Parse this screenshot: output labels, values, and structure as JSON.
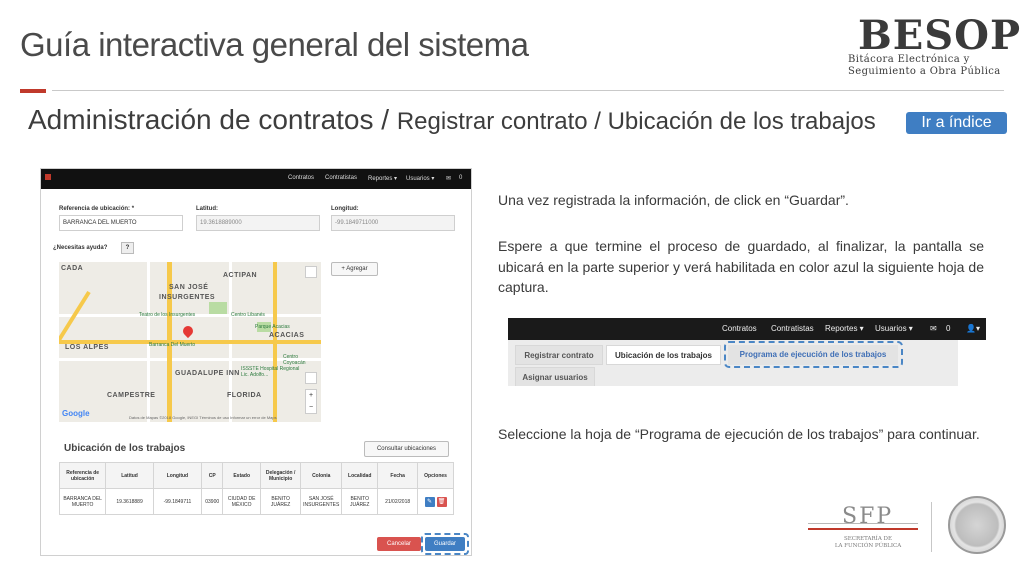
{
  "slide": {
    "title": "Guía interactiva general del sistema",
    "section_main": "Administración de contratos / ",
    "section_sub": "Registrar contrato / Ubicación de los trabajos",
    "index_button": "Ir a índice"
  },
  "logo": {
    "name": "BESOP",
    "line1": "Bitácora Electrónica y",
    "line2": "Seguimiento a Obra Pública"
  },
  "shot1": {
    "nav": [
      "Contratos",
      "Contratistas",
      "Reportes ▾",
      "Usuarios ▾",
      "✉",
      "0"
    ],
    "ref_label": "Referencia de ubicación: *",
    "ref_value": "BARRANCA DEL MUERTO",
    "lat_label": "Latitud:",
    "lat_value": "19.3618889000",
    "lon_label": "Longitud:",
    "lon_value": "-99.1849711000",
    "help_label": "¿Necesitas ayuda?",
    "help_button": "?",
    "add_button": "+ Agregar",
    "map": {
      "labels": [
        "ACTIPAN",
        "SAN JOSÉ",
        "INSURGENTES",
        "ACACIAS",
        "LOS ALPES",
        "GUADALUPE INN",
        "CAMPESTRE",
        "FLORIDA",
        "CADA"
      ],
      "pois": [
        "Teatro de los Insurgentes",
        "Centro Libanés",
        "Parque Acacias",
        "Barranca Del Muerto",
        "Centro Coyoacán",
        "ISSSTE Hospital Regional Lic. Adolfo..."
      ],
      "google": "Google",
      "credits": "Datos de Mapas ©2018 Google, INEGI   Términos de uso   Informar un error de Maps",
      "zoom_in": "+",
      "zoom_out": "−"
    },
    "table_title": "Ubicación de los trabajos",
    "consult_button": "Consultar ubicaciones",
    "columns": [
      "Referencia de ubicación",
      "Latitud",
      "Longitud",
      "CP",
      "Estado",
      "Delegación / Municipio",
      "Colonia",
      "Localidad",
      "Fecha",
      "Opciones"
    ],
    "row": [
      "BARRANCA DEL MUERTO",
      "19.3618889",
      "-99.1849711",
      "03900",
      "CIUDAD DE MÉXICO",
      "BENITO JUÁREZ",
      "SAN JOSÉ INSURGENTES",
      "BENITO JUÁREZ",
      "21/02/2018"
    ],
    "edit_icon": "✎",
    "delete_icon": "🗑",
    "cancel_button": "Cancelar",
    "save_button": "Guardar"
  },
  "text": {
    "p1": "Una vez registrada la información, de click en “Guardar”.",
    "p2": "Espere a que termine el proceso de guardado, al finalizar, la pantalla se ubicará en la parte superior y verá habilitada en color azul la siguiente hoja de captura.",
    "p3": "Seleccione la hoja de “Programa de ejecución de los trabajos” para continuar."
  },
  "shot2": {
    "nav": [
      "Contratos",
      "Contratistas",
      "Reportes ▾",
      "Usuarios ▾",
      "✉",
      "0",
      "👤▾"
    ],
    "tabs": [
      "Registrar contrato",
      "Ubicación de los trabajos",
      "Programa de ejecución de los trabajos",
      "Asignar usuarios"
    ]
  },
  "footer": {
    "sfp": "SFP",
    "sfp_sub1": "SECRETARÍA DE",
    "sfp_sub2": "LA FUNCIÓN PÚBLICA"
  },
  "colors": {
    "accent_blue": "#3f7ec3",
    "accent_red": "#c0392b"
  }
}
